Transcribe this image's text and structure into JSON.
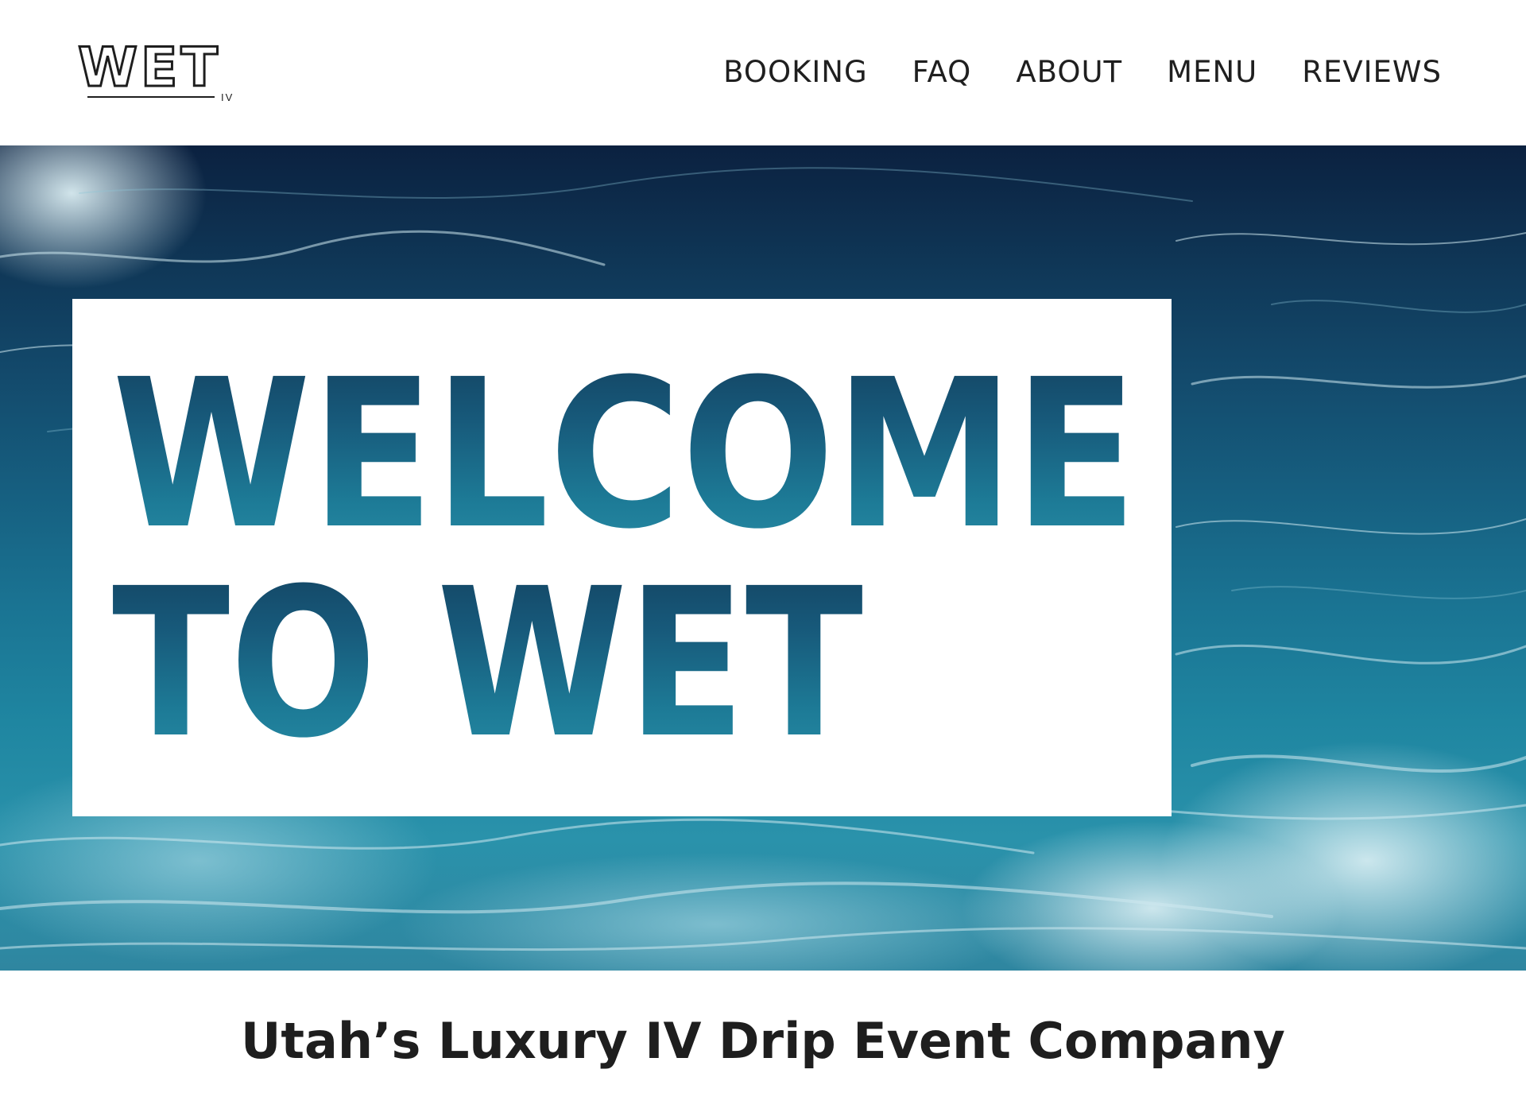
{
  "header": {
    "logo_text": "WET",
    "logo_subtext": "IV",
    "nav": [
      {
        "label": "BOOKING"
      },
      {
        "label": "FAQ"
      },
      {
        "label": "ABOUT"
      },
      {
        "label": "MENU"
      },
      {
        "label": "REVIEWS"
      }
    ]
  },
  "hero": {
    "headline_line1": "WELCOME",
    "headline_line2": "TO WET",
    "background": "ocean-waves-image"
  },
  "tagline": {
    "text": "Utah’s Luxury IV Drip Event Company"
  },
  "colors": {
    "text": "#1e1e1e",
    "ocean_dark": "#0b2140",
    "ocean_mid": "#165f80",
    "ocean_light": "#2a92ab",
    "card": "#ffffff"
  }
}
